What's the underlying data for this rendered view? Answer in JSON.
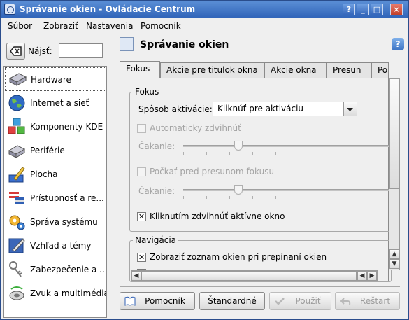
{
  "window": {
    "title": "Správanie okien - Ovládacie Centrum"
  },
  "titlebar_buttons": {
    "help": "?",
    "minimize": "_",
    "maximize": "□",
    "close": "×"
  },
  "menu": [
    {
      "label": "Súbor"
    },
    {
      "label": "Zobraziť"
    },
    {
      "label": "Nastavenia"
    },
    {
      "label": "Pomocník"
    }
  ],
  "sidebar": {
    "search_label": "Nájsť:",
    "search_value": "",
    "items": [
      {
        "label": "Hardware",
        "icon": "hardware-icon",
        "selected": true
      },
      {
        "label": "Internet a sieť",
        "icon": "globe-icon"
      },
      {
        "label": "Komponenty KDE",
        "icon": "components-icon"
      },
      {
        "label": "Periférie",
        "icon": "peripherals-icon"
      },
      {
        "label": "Plocha",
        "icon": "desktop-icon"
      },
      {
        "label": "Prístupnosť a re...",
        "icon": "accessibility-icon"
      },
      {
        "label": "Správa systému",
        "icon": "gears-icon"
      },
      {
        "label": "Vzhľad a témy",
        "icon": "appearance-icon"
      },
      {
        "label": "Zabezpečenie a ...",
        "icon": "keys-icon"
      },
      {
        "label": "Zvuk a multimédiá",
        "icon": "sound-icon"
      }
    ]
  },
  "main": {
    "title": "Správanie okien",
    "help": "?",
    "tabs": [
      {
        "label": "Fokus",
        "active": true
      },
      {
        "label": "Akcie pre titulok okna"
      },
      {
        "label": "Akcie okna"
      },
      {
        "label": "Presun"
      },
      {
        "label": "Po"
      }
    ],
    "focus_group": {
      "title": "Fokus",
      "activation_label": "Spôsob aktivácie:",
      "activation_value": "Kliknúť pre aktiváciu",
      "auto_raise_label": "Automaticky zdvihnúť",
      "auto_raise_checked": false,
      "delay_label_1": "Čakanie:",
      "delay_1_level": 0.33,
      "delay_focus_label": "Počkať pred presunom fokusu",
      "delay_focus_checked": false,
      "delay_label_2": "Čakanie:",
      "delay_2_level": 0.33,
      "click_raise_label": "Kliknutím zdvihnúť aktívne okno",
      "click_raise_checked": true
    },
    "navigation_group": {
      "title": "Navigácia",
      "show_list_label": "Zobraziť zoznam okien pri prepínaní okien",
      "show_list_checked": true
    },
    "buttons": {
      "help": "Pomocník",
      "defaults": "Štandardné",
      "apply": "Použiť",
      "reset": "Reštart"
    }
  }
}
